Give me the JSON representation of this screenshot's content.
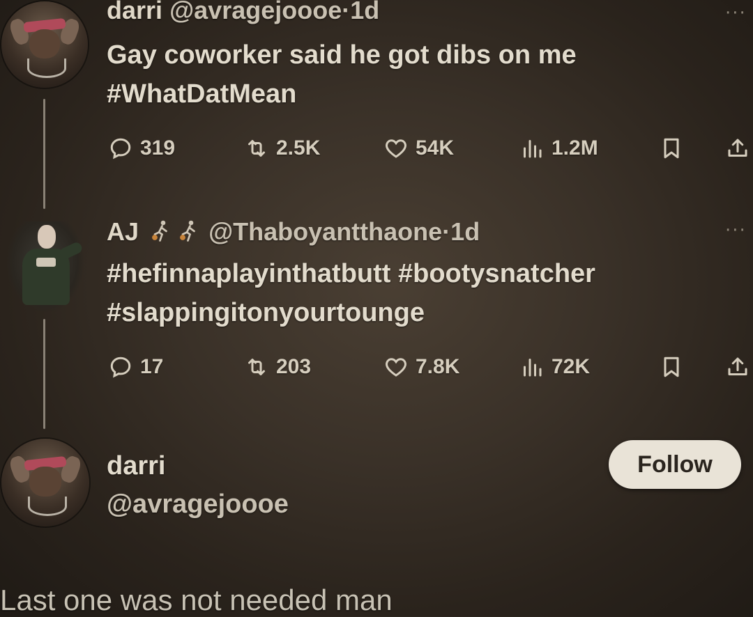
{
  "tweet1": {
    "display_name": "darri",
    "handle": "@avragejoooe",
    "separator": "·",
    "time": "1d",
    "text_line1": "Gay coworker said he got dibs on me",
    "text_line2": "#WhatDatMean",
    "replies": "319",
    "reposts": "2.5K",
    "likes": "54K",
    "views": "1.2M"
  },
  "tweet2": {
    "display_name": "AJ",
    "name_emojis": [
      "basketball-player-emoji",
      "basketball-player-emoji"
    ],
    "handle": "@Thaboyantthaone",
    "separator": "·",
    "time": "1d",
    "text_line1": "#hefinnaplayinthatbutt #bootysnatcher",
    "text_line2": "#slappingitonyourtounge",
    "replies": "17",
    "reposts": "203",
    "likes": "7.8K",
    "views": "72K"
  },
  "profile_card": {
    "display_name": "darri",
    "handle": "@avragejoooe",
    "follow_label": "Follow"
  },
  "caption": "Last one was not needed man",
  "colors": {
    "background": "#3a3128",
    "text": "#e3dccd",
    "follow_button": "#e9e3d7"
  }
}
